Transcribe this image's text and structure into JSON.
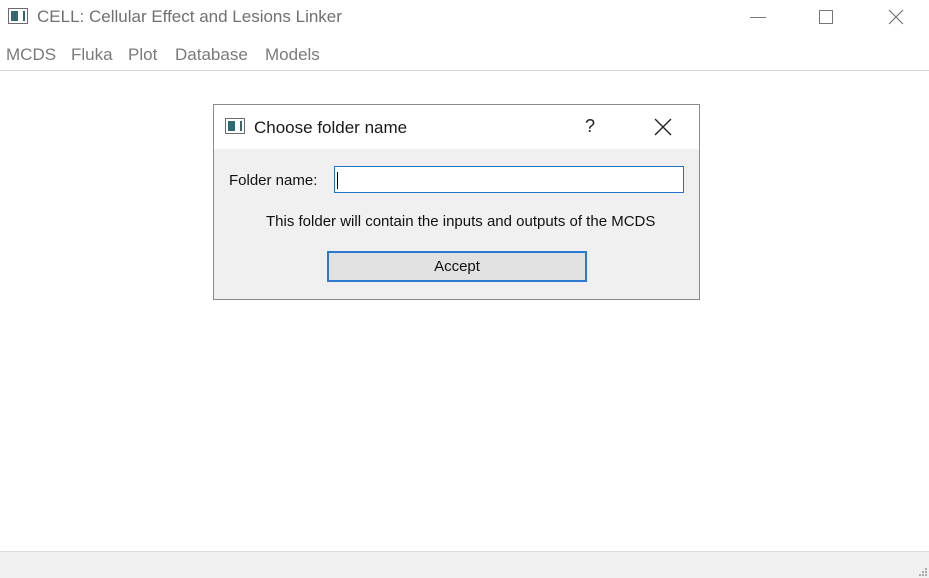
{
  "window": {
    "title": "CELL: Cellular Effect and Lesions Linker",
    "controls": [
      "minimize-icon",
      "maximize-icon",
      "close-icon"
    ]
  },
  "menubar": {
    "items": [
      {
        "label": "MCDS"
      },
      {
        "label": "Fluka"
      },
      {
        "label": "Plot"
      },
      {
        "label": "Database"
      },
      {
        "label": "Models"
      }
    ]
  },
  "dialog": {
    "title": "Choose folder name",
    "help_label": "?",
    "field_label": "Folder name:",
    "field_value": "",
    "info_text": "This folder will contain the inputs and outputs of the MCDS",
    "accept_label": "Accept"
  },
  "colors": {
    "accent": "#2b7ad0",
    "icon": "#2f6a72",
    "dialog_bg": "#f0f0f0"
  }
}
